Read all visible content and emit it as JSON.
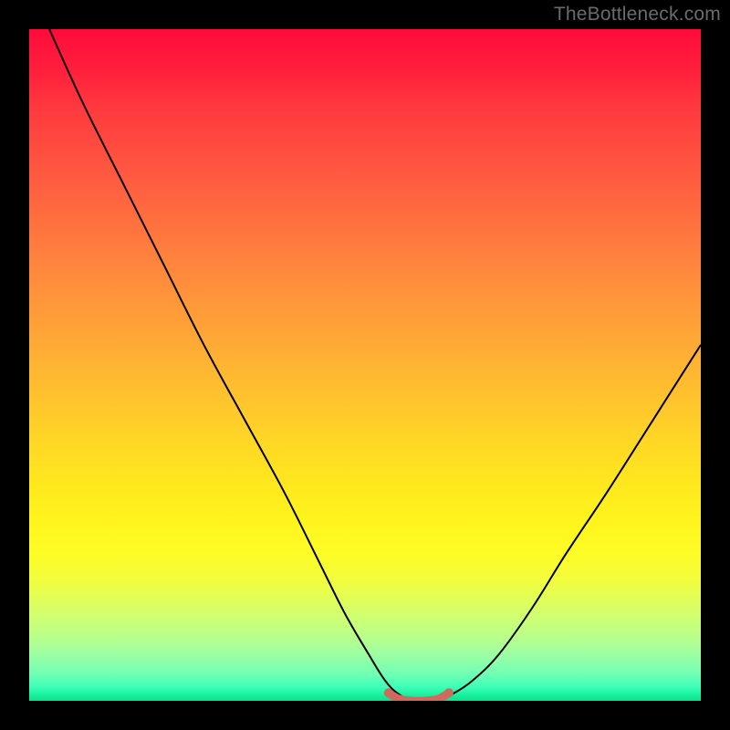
{
  "watermark": "TheBottleneck.com",
  "chart_data": {
    "type": "line",
    "title": "",
    "xlabel": "",
    "ylabel": "",
    "xlim": [
      0,
      100
    ],
    "ylim": [
      0,
      100
    ],
    "series": [
      {
        "name": "curve",
        "x": [
          3,
          8,
          14,
          20,
          26,
          32,
          38,
          43,
          47,
          50.5,
          53,
          55,
          57,
          59,
          61,
          63,
          66,
          70,
          75,
          80,
          86,
          93,
          100
        ],
        "y": [
          100,
          89,
          77,
          65,
          53,
          42,
          31,
          21,
          13,
          7,
          3,
          1,
          0,
          0,
          0,
          1,
          3,
          7,
          14,
          22,
          31,
          42,
          53
        ]
      },
      {
        "name": "bottom-marker",
        "x": [
          53.5,
          55,
          57,
          59,
          61,
          62.5
        ],
        "y": [
          1.2,
          0.3,
          0,
          0,
          0.3,
          1.2
        ]
      }
    ],
    "colors": {
      "curve": "#000000",
      "bottom_marker": "#d06a5f"
    }
  }
}
